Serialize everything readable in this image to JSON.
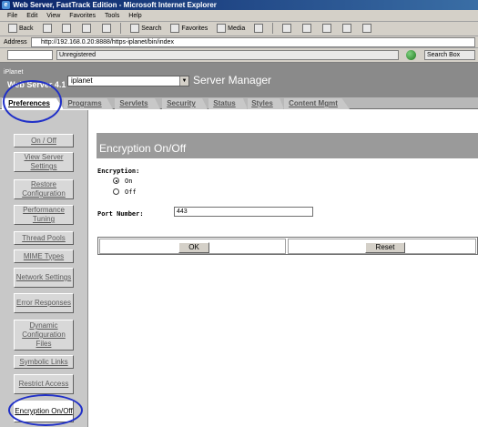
{
  "window": {
    "title": "Web Server, FastTrack Edition - Microsoft Internet Explorer"
  },
  "menu": [
    "File",
    "Edit",
    "View",
    "Favorites",
    "Tools",
    "Help"
  ],
  "toolbar": {
    "back": "Back",
    "search": "Search",
    "favorites": "Favorites",
    "media": "Media"
  },
  "address": {
    "label": "Address",
    "url": "http://192.168.0.20:8888/https-iplanet/bin/index"
  },
  "links": {
    "status": "Unregistered",
    "search_box": "Search Box"
  },
  "app": {
    "brand": "iPlanet",
    "product": "Web Server 4.1",
    "server_select": "iplanet",
    "title": "Server Manager"
  },
  "tabs": [
    "Preferences",
    "Programs",
    "Servlets",
    "Security",
    "Status",
    "Styles",
    "Content Mgmt"
  ],
  "sidebar": [
    "On / Off",
    "View Server Settings",
    "Restore Configuration",
    "Performance Tuning",
    "Thread Pools",
    "MIME Types",
    "Network Settings",
    "Error Responses",
    "Dynamic Configuration Files",
    "Symbolic Links",
    "Restrict Access",
    "Encryption On/Off"
  ],
  "page": {
    "title": "Encryption On/Off",
    "encryption_label": "Encryption:",
    "on_label": "On",
    "off_label": "Off",
    "selected": "On",
    "port_label": "Port Number:",
    "port_value": "443",
    "ok_label": "OK",
    "reset_label": "Reset"
  },
  "colors": {
    "highlight": "#2030c8",
    "header_gray": "#8a8a8a",
    "sidebar_gray": "#c8c8c8"
  }
}
